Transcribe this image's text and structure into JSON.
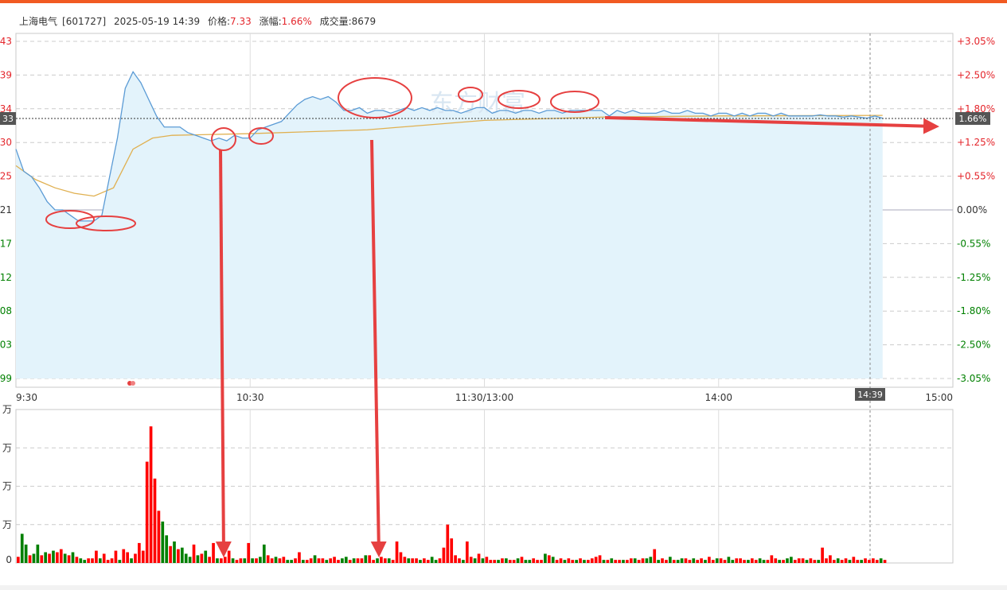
{
  "header": {
    "name": "上海电气",
    "code": "[601727]",
    "datetime": "2025-05-19 14:39",
    "price_label": "价格:",
    "price": "7.33",
    "change_label": "涨幅:",
    "change": "1.66%",
    "volume_label": "成交量:",
    "volume": "8679"
  },
  "current_pct_tag": "1.66%",
  "current_price_tag": "33",
  "current_time_tag": "14:39",
  "watermark": "东方财富",
  "colors": {
    "up": "#e4262c",
    "down": "#008000",
    "price_line": "#5b9bd5",
    "avg_line": "#e0b050",
    "area_fill": "#e3f3fb",
    "annotation": "#e64040"
  },
  "chart_data": [
    {
      "type": "line",
      "title": "",
      "x_ticks": [
        "9:30",
        "10:30",
        "11:30/13:00",
        "14:00",
        "15:00"
      ],
      "y_ticks_left": [
        "43",
        "39",
        "34",
        "30",
        "25",
        "21",
        "17",
        "12",
        "08",
        "03",
        "99"
      ],
      "y_ticks_right": [
        "+3.05%",
        "+2.50%",
        "+1.80%",
        "+1.25%",
        "+0.55%",
        "0.00%",
        "-0.55%",
        "-1.25%",
        "-1.80%",
        "-2.50%",
        "-3.05%"
      ],
      "ylim_pct": [
        -3.05,
        3.05
      ],
      "grid": true,
      "series": [
        {
          "role": "price",
          "x_minutes": [
            0,
            2,
            4,
            6,
            8,
            10,
            12,
            14,
            16,
            18,
            20,
            22,
            24,
            26,
            28,
            30,
            32,
            34,
            36,
            38,
            40,
            42,
            44,
            46,
            48,
            50,
            52,
            54,
            56,
            58,
            60,
            62,
            64,
            66,
            68,
            70,
            72,
            74,
            76,
            78,
            80,
            82,
            84,
            86,
            88,
            90,
            92,
            94,
            96,
            98,
            100,
            102,
            104,
            106,
            108,
            110,
            112,
            114,
            116,
            118,
            120,
            122,
            124,
            126,
            128,
            130,
            132,
            134,
            136,
            138,
            140,
            142,
            144,
            146,
            148,
            150,
            152,
            154,
            156,
            158,
            160,
            162,
            164,
            166,
            168,
            170,
            172,
            174,
            176,
            178,
            180,
            182,
            184,
            186,
            188,
            190,
            192,
            194,
            196,
            198,
            200,
            202,
            204,
            206,
            208,
            210,
            212,
            214,
            216,
            218,
            220,
            222
          ],
          "y_pct": [
            1.1,
            0.7,
            0.6,
            0.4,
            0.15,
            0.0,
            0.0,
            -0.1,
            -0.2,
            -0.2,
            -0.2,
            -0.1,
            0.6,
            1.3,
            2.2,
            2.5,
            2.3,
            2.0,
            1.7,
            1.5,
            1.5,
            1.5,
            1.4,
            1.35,
            1.3,
            1.25,
            1.3,
            1.25,
            1.35,
            1.3,
            1.3,
            1.45,
            1.5,
            1.55,
            1.6,
            1.75,
            1.9,
            2.0,
            2.05,
            2.0,
            2.05,
            1.95,
            1.8,
            1.8,
            1.85,
            1.75,
            1.8,
            1.8,
            1.75,
            1.8,
            1.85,
            1.8,
            1.85,
            1.8,
            1.85,
            1.8,
            1.8,
            1.75,
            1.8,
            1.85,
            1.85,
            1.75,
            1.8,
            1.8,
            1.75,
            1.8,
            1.8,
            1.75,
            1.8,
            1.8,
            1.75,
            1.8,
            1.8,
            1.8,
            1.8,
            1.8,
            1.7,
            1.8,
            1.75,
            1.8,
            1.75,
            1.75,
            1.75,
            1.8,
            1.75,
            1.75,
            1.8,
            1.75,
            1.75,
            1.7,
            1.75,
            1.75,
            1.7,
            1.75,
            1.7,
            1.75,
            1.75,
            1.7,
            1.75,
            1.7,
            1.7,
            1.7,
            1.7,
            1.72,
            1.7,
            1.7,
            1.68,
            1.7,
            1.68,
            1.66,
            1.7,
            1.66
          ]
        },
        {
          "role": "average",
          "x_minutes": [
            0,
            5,
            10,
            15,
            20,
            25,
            30,
            35,
            40,
            60,
            90,
            120,
            150,
            180,
            222
          ],
          "y_pct": [
            0.8,
            0.55,
            0.4,
            0.3,
            0.25,
            0.4,
            1.1,
            1.3,
            1.35,
            1.38,
            1.45,
            1.62,
            1.68,
            1.7,
            1.71
          ]
        }
      ]
    },
    {
      "type": "bar",
      "title": "",
      "y_ticks_left": [
        "万",
        "万",
        "万",
        "万",
        "0"
      ],
      "x_minutes": [
        0,
        1,
        2,
        3,
        4,
        5,
        6,
        7,
        8,
        9,
        10,
        11,
        12,
        13,
        14,
        15,
        16,
        17,
        18,
        19,
        20,
        21,
        22,
        23,
        24,
        25,
        26,
        27,
        28,
        29,
        30,
        31,
        32,
        33,
        34,
        35,
        36,
        37,
        38,
        39,
        40,
        41,
        42,
        43,
        44,
        45,
        46,
        47,
        48,
        49,
        50,
        51,
        52,
        53,
        54,
        55,
        56,
        57,
        58,
        59,
        60,
        61,
        62,
        63,
        64,
        65,
        66,
        67,
        68,
        69,
        70,
        71,
        72,
        73,
        74,
        75,
        76,
        77,
        78,
        79,
        80,
        81,
        82,
        83,
        84,
        85,
        86,
        87,
        88,
        89,
        90,
        91,
        92,
        93,
        94,
        95,
        96,
        97,
        98,
        99,
        100,
        101,
        102,
        103,
        104,
        105,
        106,
        107,
        108,
        109,
        110,
        111,
        112,
        113,
        114,
        115,
        116,
        117,
        118,
        119,
        120,
        121,
        122,
        123,
        124,
        125,
        126,
        127,
        128,
        129,
        130,
        131,
        132,
        133,
        134,
        135,
        136,
        137,
        138,
        139,
        140,
        141,
        142,
        143,
        144,
        145,
        146,
        147,
        148,
        149,
        150,
        151,
        152,
        153,
        154,
        155,
        156,
        157,
        158,
        159,
        160,
        161,
        162,
        163,
        164,
        165,
        166,
        167,
        168,
        169,
        170,
        171,
        172,
        173,
        174,
        175,
        176,
        177,
        178,
        179,
        180,
        181,
        182,
        183,
        184,
        185,
        186,
        187,
        188,
        189,
        190,
        191,
        192,
        193,
        194,
        195,
        196,
        197,
        198,
        199,
        200,
        201,
        202,
        203,
        204,
        205,
        206,
        207,
        208,
        209,
        210,
        211,
        212,
        213,
        214,
        215,
        216,
        217,
        218,
        219,
        220,
        221,
        222
      ],
      "values_pct_of_axis": [
        4,
        19,
        12,
        5,
        6,
        12,
        5,
        7,
        6,
        8,
        7,
        9,
        6,
        5,
        7,
        4,
        3,
        2,
        3,
        3,
        8,
        3,
        6,
        2,
        3,
        8,
        2,
        9,
        7,
        3,
        6,
        13,
        8,
        66,
        89,
        55,
        34,
        27,
        18,
        11,
        14,
        9,
        10,
        6,
        4,
        12,
        5,
        6,
        8,
        4,
        13,
        3,
        3,
        4,
        8,
        3,
        2,
        3,
        3,
        13,
        3,
        3,
        4,
        12,
        5,
        3,
        4,
        3,
        4,
        2,
        2,
        3,
        7,
        2,
        2,
        3,
        5,
        3,
        3,
        2,
        3,
        4,
        2,
        3,
        4,
        2,
        3,
        3,
        3,
        5,
        5,
        2,
        3,
        4,
        3,
        3,
        2,
        14,
        7,
        4,
        3,
        3,
        3,
        2,
        3,
        2,
        4,
        2,
        3,
        10,
        25,
        16,
        5,
        3,
        2,
        14,
        4,
        3,
        6,
        3,
        4,
        2,
        2,
        2,
        3,
        3,
        2,
        2,
        3,
        4,
        2,
        2,
        3,
        2,
        2,
        6,
        5,
        4,
        2,
        3,
        2,
        3,
        2,
        2,
        3,
        2,
        2,
        3,
        4,
        5,
        2,
        2,
        3,
        2,
        2,
        2,
        2,
        3,
        3,
        2,
        3,
        3,
        4,
        9,
        2,
        3,
        2,
        4,
        2,
        2,
        3,
        3,
        2,
        3,
        2,
        3,
        2,
        4,
        2,
        3,
        3,
        2,
        4,
        2,
        3,
        3,
        2,
        2,
        3,
        2,
        3,
        2,
        2,
        5,
        3,
        2,
        2,
        3,
        4,
        2,
        3,
        3,
        2,
        3,
        2,
        2,
        10,
        3,
        5,
        2,
        3,
        2,
        3,
        2,
        4,
        2,
        2,
        3,
        2,
        3,
        2,
        3,
        2,
        3,
        8,
        5,
        2
      ],
      "colors_up_down": [
        "r",
        "g",
        "g",
        "r",
        "g",
        "g",
        "r",
        "g",
        "r",
        "g",
        "r",
        "r",
        "g",
        "r",
        "g",
        "r",
        "g",
        "g",
        "r",
        "r",
        "r",
        "g",
        "r",
        "r",
        "r",
        "r",
        "g",
        "r",
        "r",
        "g",
        "r",
        "r",
        "r",
        "r",
        "r",
        "r",
        "r",
        "g",
        "g",
        "r",
        "g",
        "r",
        "g",
        "g",
        "g",
        "r",
        "g",
        "r",
        "g",
        "r",
        "r",
        "g",
        "r",
        "r",
        "r",
        "g",
        "r",
        "r",
        "g",
        "r",
        "g",
        "r",
        "g",
        "g",
        "r",
        "r",
        "g",
        "r",
        "r",
        "g",
        "g",
        "r",
        "r",
        "g",
        "r",
        "r",
        "g",
        "r",
        "r",
        "g",
        "r",
        "r",
        "r",
        "g",
        "g",
        "r",
        "g",
        "r",
        "r",
        "g",
        "r",
        "r",
        "g",
        "r",
        "r",
        "g",
        "r",
        "r",
        "r",
        "r",
        "g",
        "r",
        "r",
        "g",
        "r",
        "r",
        "g",
        "g",
        "r",
        "r",
        "r",
        "r",
        "r",
        "r",
        "g",
        "r",
        "r",
        "g",
        "r",
        "g",
        "r",
        "r",
        "r",
        "g",
        "r",
        "g",
        "r",
        "r",
        "g",
        "r",
        "g",
        "g",
        "r",
        "r",
        "r",
        "g",
        "r",
        "g",
        "r",
        "r",
        "g",
        "r",
        "r",
        "g",
        "r",
        "g",
        "r",
        "r",
        "r",
        "r",
        "g",
        "r",
        "g",
        "r",
        "r",
        "g",
        "r",
        "r",
        "g",
        "r",
        "r",
        "g",
        "g",
        "r",
        "g",
        "r",
        "r",
        "g",
        "r",
        "g",
        "g",
        "r",
        "r",
        "g",
        "r",
        "r",
        "g",
        "r",
        "r",
        "g",
        "r",
        "r",
        "g",
        "g",
        "r",
        "r",
        "r",
        "g",
        "r",
        "r",
        "g",
        "g",
        "r",
        "r",
        "r",
        "g",
        "r",
        "g",
        "g",
        "r",
        "r",
        "r",
        "g",
        "r",
        "r",
        "g",
        "r",
        "r",
        "r",
        "r",
        "g",
        "r",
        "r",
        "g",
        "r",
        "r",
        "g",
        "r",
        "r",
        "r",
        "r",
        "g",
        "r",
        "r",
        "r"
      ]
    }
  ]
}
